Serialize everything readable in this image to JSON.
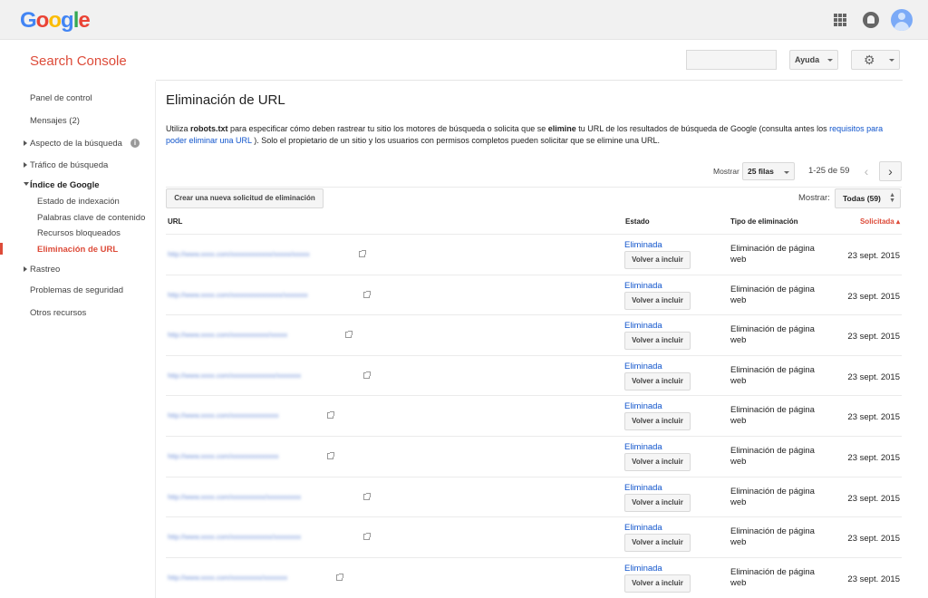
{
  "google_logo": {
    "letters": [
      "G",
      "o",
      "o",
      "g",
      "l",
      "e"
    ],
    "colors": [
      "#4285f4",
      "#ea4335",
      "#fbbc05",
      "#4285f4",
      "#34a853",
      "#ea4335"
    ]
  },
  "header": {
    "product_title": "Search Console",
    "help_label": "Ayuda",
    "accent_color": "#dd4b39"
  },
  "sidebar": {
    "items": [
      {
        "label": "Panel de control"
      },
      {
        "label": "Mensajes (2)"
      },
      {
        "label": "Aspecto de la búsqueda"
      },
      {
        "label": "Tráfico de búsqueda"
      },
      {
        "label": "Índice de Google"
      },
      {
        "label": "Estado de indexación"
      },
      {
        "label": "Palabras clave de contenido"
      },
      {
        "label": "Recursos bloqueados"
      },
      {
        "label": "Eliminación de URL"
      },
      {
        "label": "Rastreo"
      },
      {
        "label": "Problemas de seguridad"
      },
      {
        "label": "Otros recursos"
      }
    ]
  },
  "main": {
    "title": "Eliminación de URL",
    "desc_1": "Utiliza ",
    "desc_robots": "robots.txt",
    "desc_2": " para especificar cómo deben rastrear tu sitio los motores de búsqueda o solicita que se ",
    "desc_elimine": "elimine",
    "desc_3": " tu URL de los resultados de búsqueda de Google (consulta antes los ",
    "desc_link": "requisitos para poder eliminar una URL",
    "desc_4": " ). Solo el propietario de un sitio y los usuarios con permisos completos pueden solicitar que se elimine una URL.",
    "show_label": "Mostrar",
    "rows_select": "25 filas",
    "range": "1-25 de 59",
    "create_button": "Crear una nueva solicitud de eliminación",
    "filter_label": "Mostrar:",
    "filter_select": "Todas (59)",
    "table": {
      "headers": [
        "URL",
        "Estado",
        "Tipo de eliminación",
        "Solicitada ▴"
      ],
      "rows": [
        {
          "url": "http://www.xxxx.com/xxxxxxxxxxxx/xxxxx/xxxxx",
          "status": "Eliminada",
          "action": "Volver a incluir",
          "type": "Eliminación de página web",
          "date": "23 sept. 2015"
        },
        {
          "url": "http://www.xxxx.com/xxxxxxxxxxxxxxx/xxxxxxx",
          "status": "Eliminada",
          "action": "Volver a incluir",
          "type": "Eliminación de página web",
          "date": "23 sept. 2015"
        },
        {
          "url": "http://www.xxxx.com/xxxxxxxxxxx/xxxxx",
          "status": "Eliminada",
          "action": "Volver a incluir",
          "type": "Eliminación de página web",
          "date": "23 sept. 2015"
        },
        {
          "url": "http://www.xxxx.com/xxxxxxxxxxxxx/xxxxxxx",
          "status": "Eliminada",
          "action": "Volver a incluir",
          "type": "Eliminación de página web",
          "date": "23 sept. 2015"
        },
        {
          "url": "http://www.xxxx.com/xxxxxxxxxxxxxx",
          "status": "Eliminada",
          "action": "Volver a incluir",
          "type": "Eliminación de página web",
          "date": "23 sept. 2015"
        },
        {
          "url": "http://www.xxxx.com/xxxxxxxxxxxxxx",
          "status": "Eliminada",
          "action": "Volver a incluir",
          "type": "Eliminación de página web",
          "date": "23 sept. 2015"
        },
        {
          "url": "http://www.xxxx.com/xxxxxxxxxx/xxxxxxxxxx",
          "status": "Eliminada",
          "action": "Volver a incluir",
          "type": "Eliminación de página web",
          "date": "23 sept. 2015"
        },
        {
          "url": "http://www.xxxx.com/xxxxxxxxxxxx/xxxxxxxx",
          "status": "Eliminada",
          "action": "Volver a incluir",
          "type": "Eliminación de página web",
          "date": "23 sept. 2015"
        },
        {
          "url": "http://www.xxxx.com/xxxxxxxxx/xxxxxxx",
          "status": "Eliminada",
          "action": "Volver a incluir",
          "type": "Eliminación de página web",
          "date": "23 sept. 2015"
        }
      ]
    }
  }
}
